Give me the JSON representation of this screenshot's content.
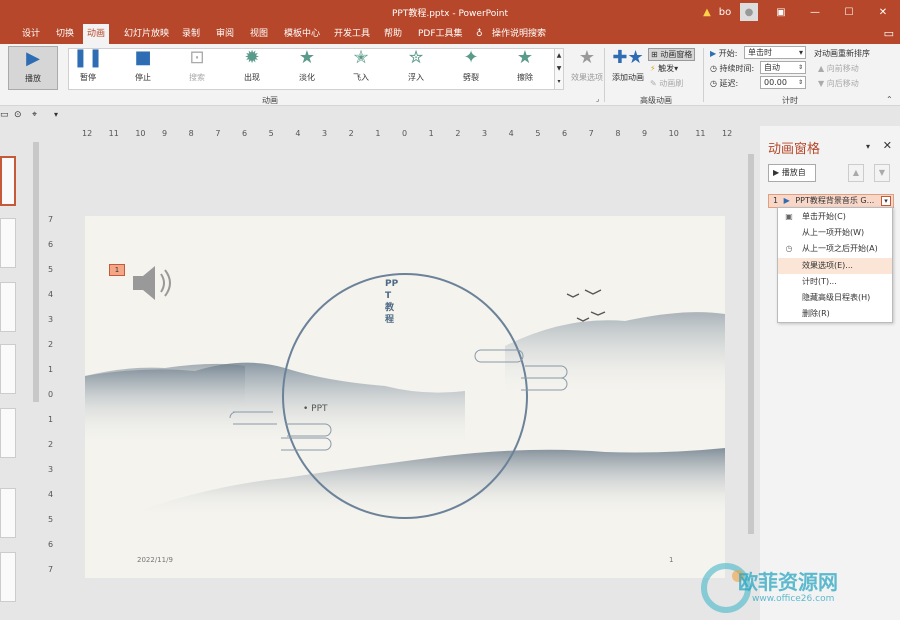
{
  "window": {
    "title": "PPT教程.pptx  -  PowerPoint",
    "user": "bo"
  },
  "tabs": [
    "设计",
    "切换",
    "动画",
    "幻灯片放映",
    "录制",
    "审阅",
    "视图",
    "模板中心",
    "开发工具",
    "帮助",
    "PDF工具集",
    "操作说明搜索"
  ],
  "ribbon": {
    "preview": "播放",
    "effects": [
      "暂停",
      "停止",
      "搜索",
      "出现",
      "淡化",
      "飞入",
      "浮入",
      "劈裂",
      "擦除"
    ],
    "effect_options": "效果选项",
    "group_animation": "动画",
    "add_animation": "添加动画",
    "animation_pane_btn": "动画窗格",
    "trigger": "触发",
    "painter": "动画刷",
    "group_advanced": "高级动画",
    "start_label": "开始:",
    "start_value": "单击时",
    "duration_label": "持续时间:",
    "duration_value": "自动",
    "delay_label": "延迟:",
    "delay_value": "00.00",
    "reorder_label": "对动画重新排序",
    "move_earlier": "向前移动",
    "move_later": "向后移动",
    "group_timing": "计时"
  },
  "ruler_h": [
    "12",
    "11",
    "10",
    "9",
    "8",
    "7",
    "6",
    "5",
    "4",
    "3",
    "2",
    "1",
    "0",
    "1",
    "2",
    "3",
    "4",
    "5",
    "6",
    "7",
    "8",
    "9",
    "10",
    "11",
    "12"
  ],
  "ruler_v": [
    "7",
    "6",
    "5",
    "4",
    "3",
    "2",
    "1",
    "0",
    "1",
    "2",
    "3",
    "4",
    "5",
    "6",
    "7"
  ],
  "slide": {
    "anim_tag": "1",
    "vertical_title": "PPT教程",
    "subtitle": "PPT",
    "date": "2022/11/9",
    "page": "1"
  },
  "pane": {
    "title": "动画窗格",
    "play_from": "播放自",
    "item_number": "1",
    "item_text": "PPT教程背景音乐 G...",
    "menu": [
      "单击开始(C)",
      "从上一项开始(W)",
      "从上一项之后开始(A)",
      "效果选项(E)...",
      "计时(T)...",
      "隐藏高级日程表(H)",
      "删除(R)"
    ]
  },
  "watermark": {
    "text": "欧菲资源网",
    "url": "www.office26.com"
  },
  "colors": {
    "accent": "#b7472a",
    "highlight": "#fbe5d6",
    "star": "#5a9a8a"
  }
}
